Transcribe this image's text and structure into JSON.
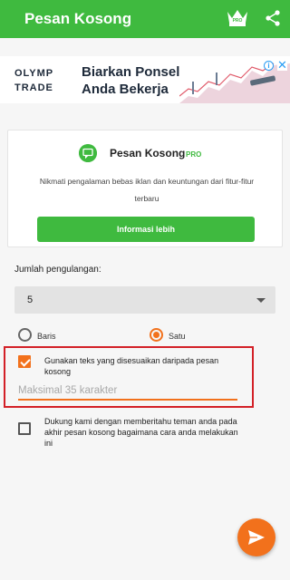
{
  "appbar": {
    "title": "Pesan Kosong",
    "crown_badge": "PRO",
    "bg": "#3fba3f"
  },
  "ad": {
    "logo_line1": "OLYMP",
    "logo_line2": "TRADE",
    "headline": "Biarkan Ponsel Anda Bekerja",
    "info_icon": "i",
    "close_icon": "✕"
  },
  "pro_card": {
    "title": "Pesan Kosong",
    "pro_label": "PRO",
    "description": "Nikmati pengalaman bebas iklan dan keuntungan dari fitur-fitur terbaru",
    "button_label": "Informasi lebih"
  },
  "repeat": {
    "label": "Jumlah pengulangan:",
    "selected": "5"
  },
  "mode": {
    "option1": "Baris",
    "option2": "Satu",
    "selected": "Satu"
  },
  "custom_text": {
    "checked": true,
    "label": "Gunakan teks yang disesuaikan daripada pesan kosong",
    "placeholder": "Maksimal 35 karakter",
    "value": ""
  },
  "support": {
    "checked": false,
    "label": "Dukung kami dengan memberitahu teman anda pada akhir pesan kosong bagaimana cara anda melakukan ini"
  },
  "colors": {
    "accent": "#f2711c",
    "primary": "#3fba3f",
    "highlight_border": "#d32027"
  }
}
